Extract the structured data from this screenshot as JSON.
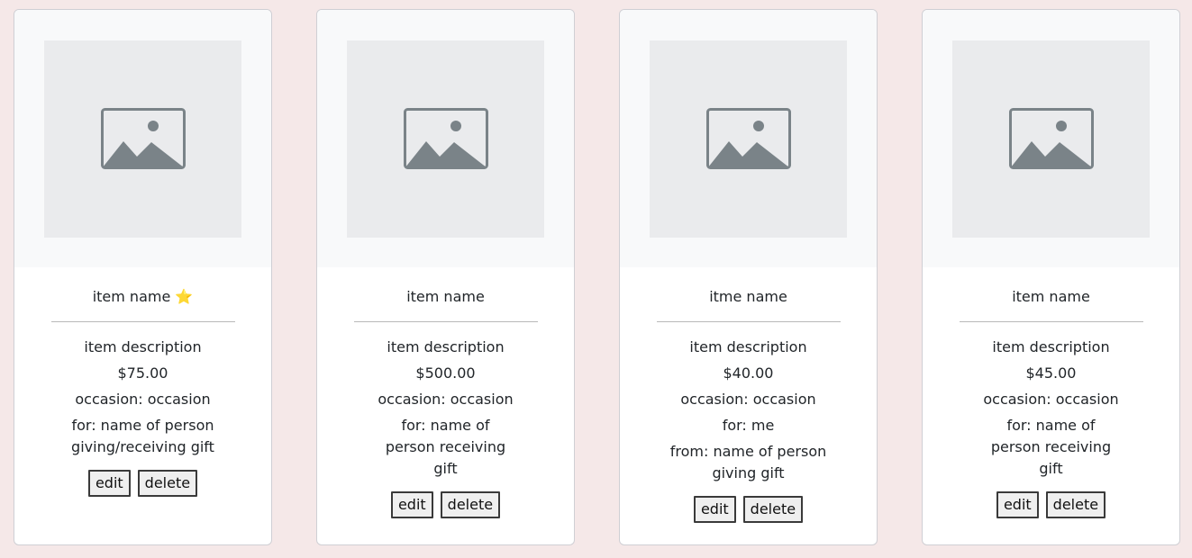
{
  "cards": [
    {
      "name": "item name",
      "star": "⭐",
      "description": "item description",
      "price": "$75.00",
      "occasion": "occasion: occasion",
      "for": "for: name of person giving/receiving gift",
      "from": "",
      "edit_label": "edit",
      "delete_label": "delete"
    },
    {
      "name": "item name",
      "star": "",
      "description": "item description",
      "price": "$500.00",
      "occasion": "occasion: occasion",
      "for": "for: name of person receiving gift",
      "from": "",
      "edit_label": "edit",
      "delete_label": "delete"
    },
    {
      "name": "itme name",
      "star": "",
      "description": "item description",
      "price": "$40.00",
      "occasion": "occasion: occasion",
      "for": "for: me",
      "from": "from: name of person giving gift",
      "edit_label": "edit",
      "delete_label": "delete"
    },
    {
      "name": "item name",
      "star": "",
      "description": "item description",
      "price": "$45.00",
      "occasion": "occasion: occasion",
      "for": "for: name of person receiving gift",
      "from": "",
      "edit_label": "edit",
      "delete_label": "delete"
    }
  ],
  "colors": {
    "page_background": "#f5e8e8",
    "card_background": "#ffffff",
    "image_area_background": "#f8f9fa",
    "placeholder_background": "#eaebed",
    "placeholder_icon": "#7a8388"
  },
  "icons": {
    "placeholder": "image-placeholder-icon"
  }
}
